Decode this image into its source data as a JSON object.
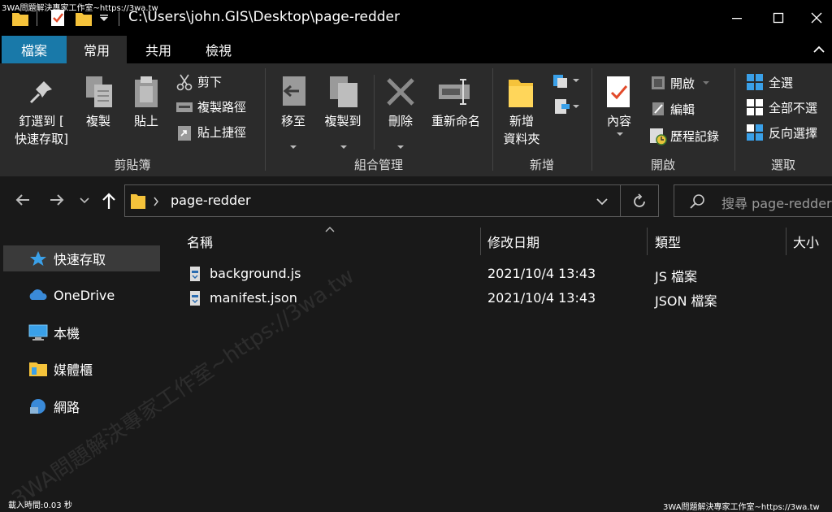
{
  "window": {
    "title_path": "C:\\Users\\john.GIS\\Desktop\\page-redder",
    "watermark_top": "3WA問題解決專家工作室~https://3wa.tw",
    "watermark_bottom": "3WA問題解決專家工作室~https://3wa.tw",
    "watermark_diagonal": "3WA問題解決專家工作室~https://3wa.tw"
  },
  "tabs": [
    {
      "label": "檔案"
    },
    {
      "label": "常用"
    },
    {
      "label": "共用"
    },
    {
      "label": "檢視"
    }
  ],
  "ribbon": {
    "clipboard": {
      "pin_label_1": "釘選到 [",
      "pin_label_2": "快速存取]",
      "copy": "複製",
      "paste": "貼上",
      "cut": "剪下",
      "copy_path": "複製路徑",
      "paste_shortcut": "貼上捷徑",
      "group": "剪貼簿"
    },
    "organize": {
      "move_to": "移至",
      "copy_to": "複製到",
      "delete": "刪除",
      "rename": "重新命名",
      "group": "組合管理"
    },
    "new": {
      "new_folder_1": "新增",
      "new_folder_2": "資料夾",
      "group": "新增"
    },
    "open": {
      "properties": "內容",
      "open": "開啟",
      "edit": "編輯",
      "history": "歷程記錄",
      "group": "開啟"
    },
    "select": {
      "select_all": "全選",
      "select_none": "全部不選",
      "invert": "反向選擇",
      "group": "選取"
    }
  },
  "address": {
    "crumb": "page-redder",
    "search_placeholder": "搜尋 page-redder"
  },
  "nav": [
    {
      "label": "快速存取"
    },
    {
      "label": "OneDrive"
    },
    {
      "label": "本機"
    },
    {
      "label": "媒體櫃"
    },
    {
      "label": "網路"
    }
  ],
  "columns": {
    "name": "名稱",
    "modified": "修改日期",
    "type": "類型",
    "size": "大小"
  },
  "files": [
    {
      "name": "background.js",
      "modified": "2021/10/4 13:43",
      "type": "JS 檔案"
    },
    {
      "name": "manifest.json",
      "modified": "2021/10/4 13:43",
      "type": "JSON 檔案"
    }
  ],
  "status": {
    "load_time": "載入時間:0.03 秒"
  },
  "colors": {
    "file_tab": "#1979a9",
    "ribbon_bg": "#2b2b2b",
    "window_bg": "#191919",
    "select_blue": "#3aa0e8"
  }
}
